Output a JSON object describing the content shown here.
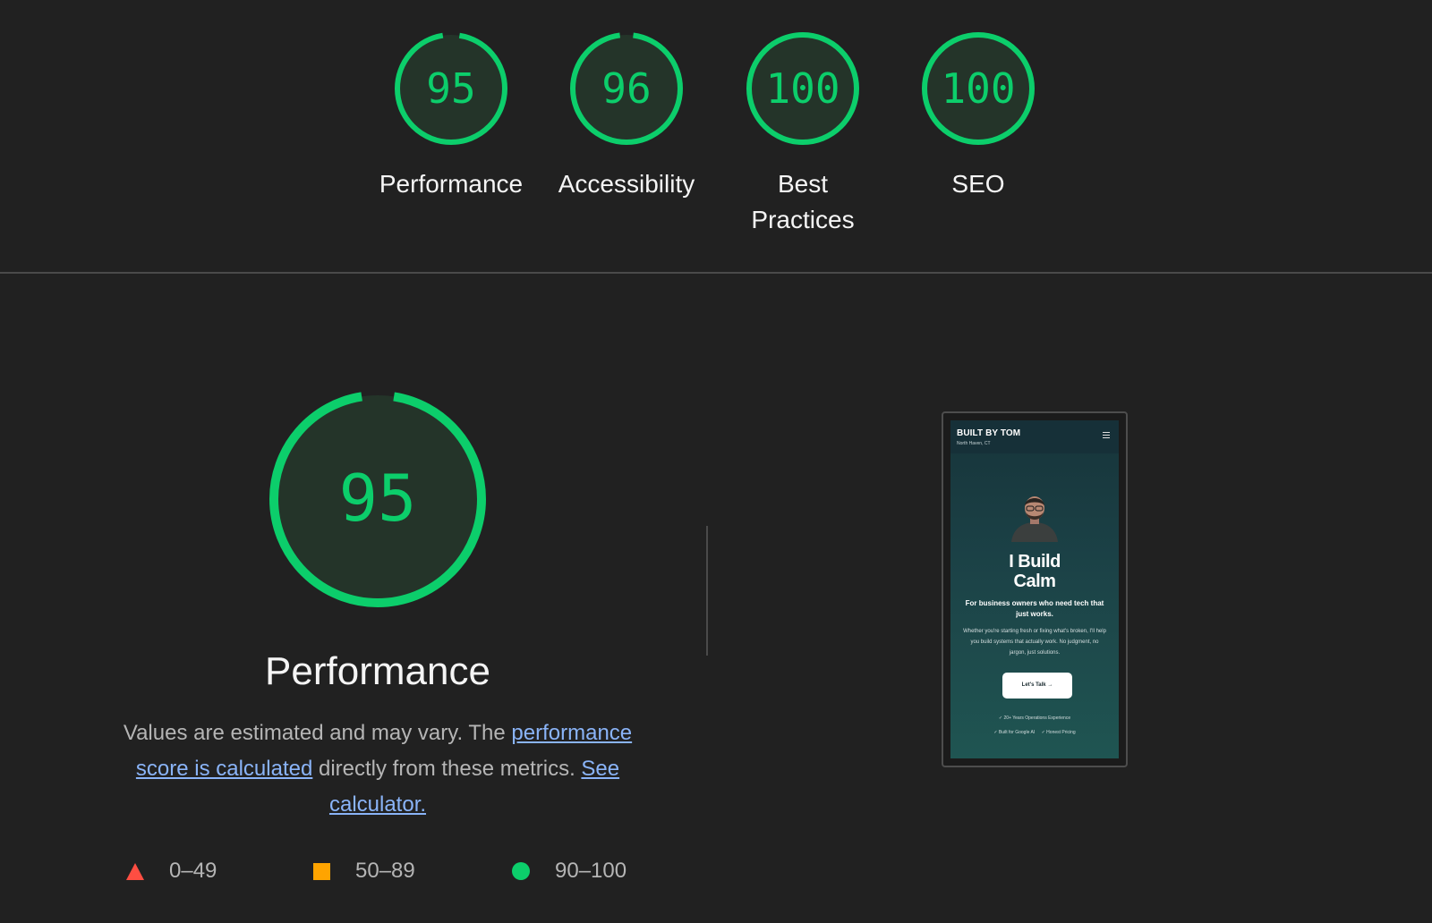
{
  "gauges": [
    {
      "score": "95",
      "value": 95,
      "label": "Performance"
    },
    {
      "score": "96",
      "value": 96,
      "label": "Accessibility"
    },
    {
      "score": "100",
      "value": 100,
      "label": "Best Practices"
    },
    {
      "score": "100",
      "value": 100,
      "label": "SEO"
    }
  ],
  "main": {
    "score": "95",
    "value": 95,
    "title": "Performance",
    "desc_prefix": "Values are estimated and may vary. The ",
    "desc_link1": "performance score is calculated",
    "desc_middle": " directly from these metrics. ",
    "desc_link2": "See calculator."
  },
  "legend": {
    "fail_range": "0–49",
    "average_range": "50–89",
    "pass_range": "90–100"
  },
  "phone": {
    "brand": "BUILT BY TOM",
    "location": "North Haven, CT",
    "hero_title_line1": "I Build",
    "hero_title_line2": "Calm",
    "hero_subtitle": "For business owners who need tech that just works.",
    "hero_body": "Whether you're starting fresh or fixing what's broken, I'll help you build systems that actually work. No judgment, no jargon, just solutions.",
    "cta_label": "Let's Talk →",
    "check1": "✓ 20+ Years Operations Experience",
    "check2": "✓ Built for Google AI",
    "check3": "✓ Honest Pricing"
  },
  "colors": {
    "pass": "#0cce6b",
    "average": "#ffa400",
    "fail": "#ff4e42",
    "link": "#8ab4f8",
    "background": "#212121"
  },
  "icons": {
    "menu": "hamburger-menu-icon",
    "fail": "triangle-icon",
    "average": "square-icon",
    "pass": "circle-icon"
  }
}
